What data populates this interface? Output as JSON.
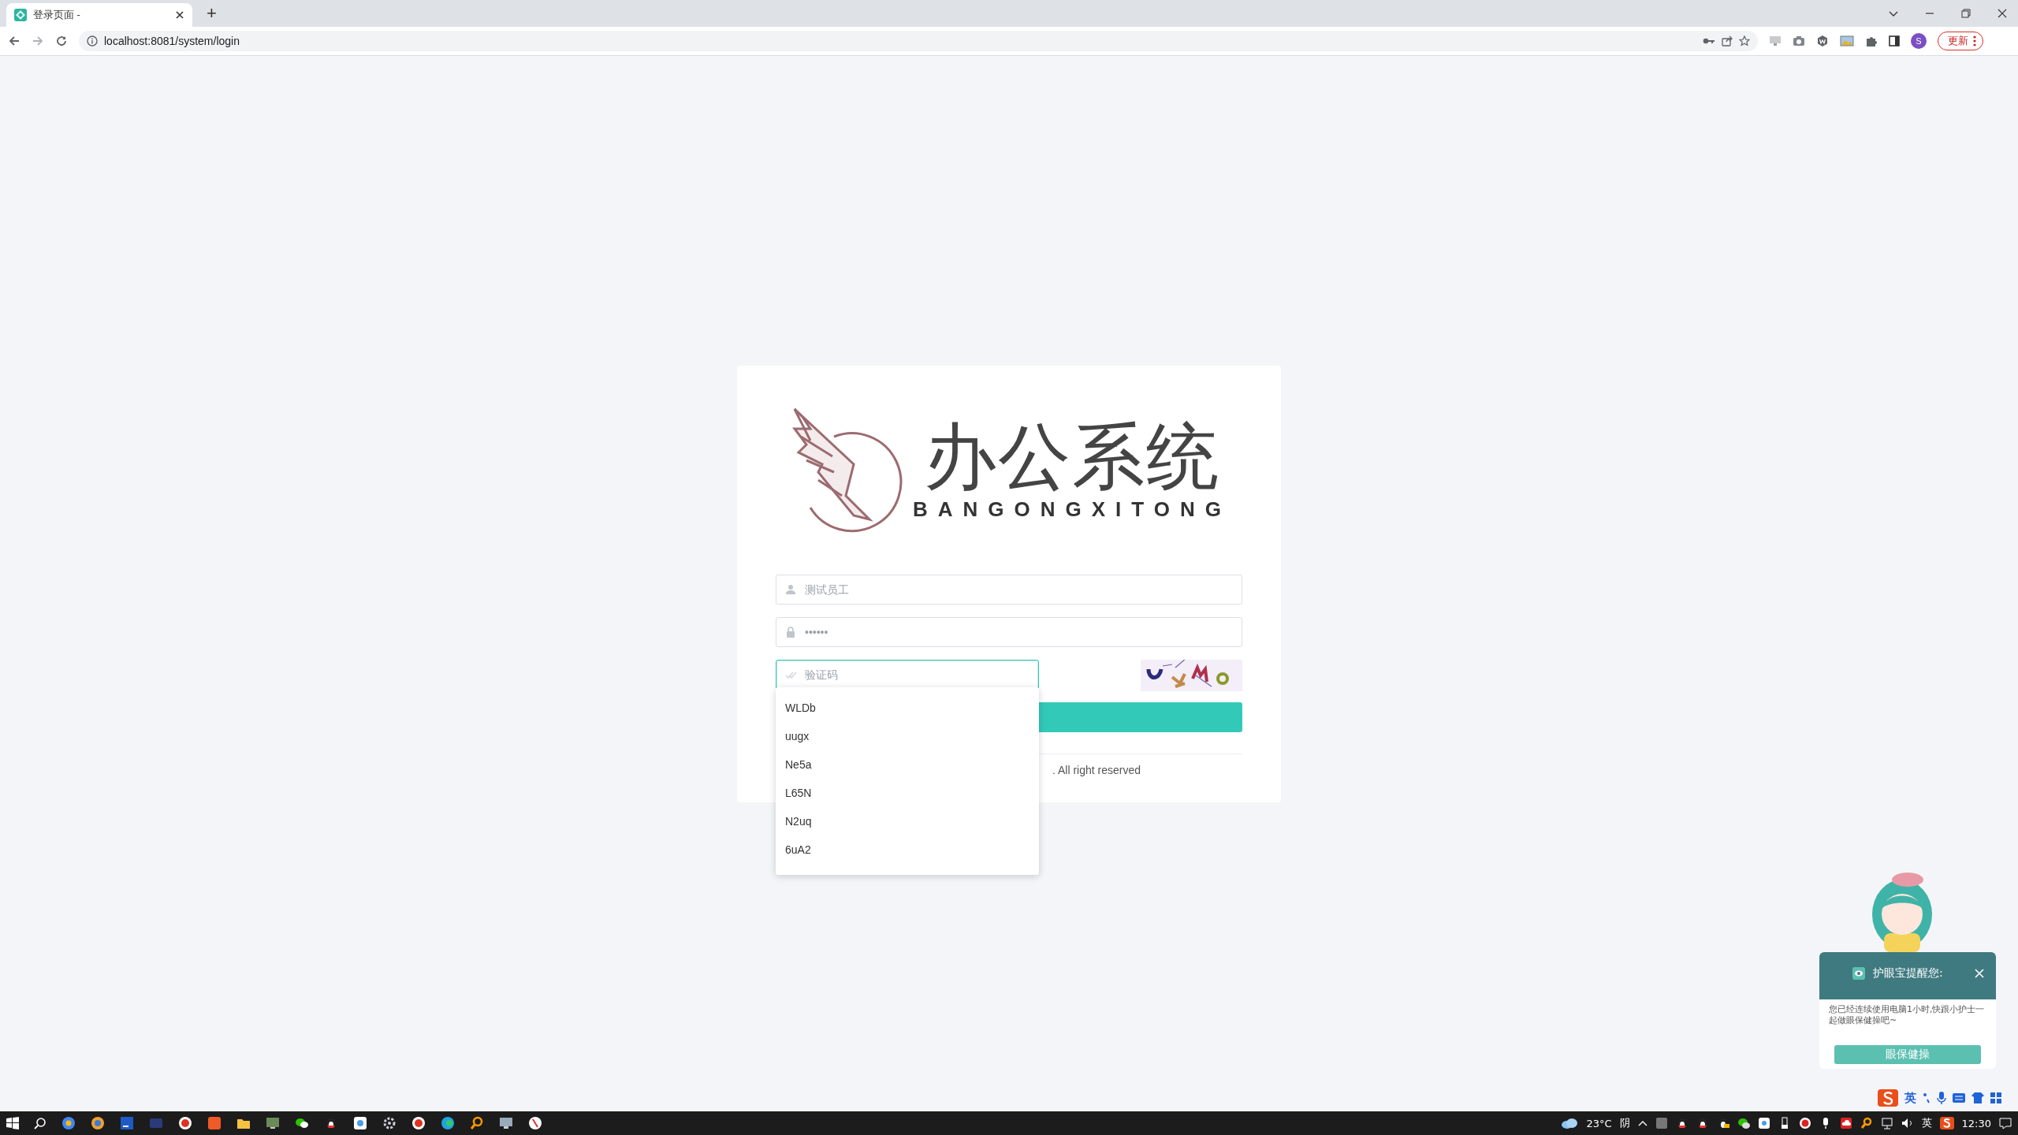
{
  "browser": {
    "tabs": [
      {
        "title": "登录页面 -",
        "selected": true
      }
    ],
    "new_tab": "+",
    "address": "localhost:8081/system/login",
    "update_button": "更新",
    "profile": "S"
  },
  "login": {
    "logo_title": "办公系统",
    "logo_subtitle": "BANGONGXITONG",
    "fields": [
      {
        "kind": "user",
        "placeholder": "测试员工",
        "focused": false
      },
      {
        "kind": "password",
        "placeholder": "••••••",
        "focused": false
      },
      {
        "kind": "captcha",
        "placeholder": "验证码",
        "focused": true
      }
    ],
    "suggestions": [
      {
        "text": "WLDb"
      },
      {
        "text": "uugx"
      },
      {
        "text": "Ne5a"
      },
      {
        "text": "L65N"
      },
      {
        "text": "N2uq"
      },
      {
        "text": "6uA2"
      }
    ],
    "footer": ". All right reserved"
  },
  "eye_reminder": {
    "title": "护眼宝提醒您:",
    "message": "您已经连续使用电脑1小时,快跟小护士一起做眼保健操吧~",
    "button": "眼保健操"
  },
  "ime_bar": {
    "mode": "英"
  },
  "taskbar": {
    "weather": "23°C",
    "condition": "阴",
    "ime": "英",
    "clock": "12:30"
  }
}
